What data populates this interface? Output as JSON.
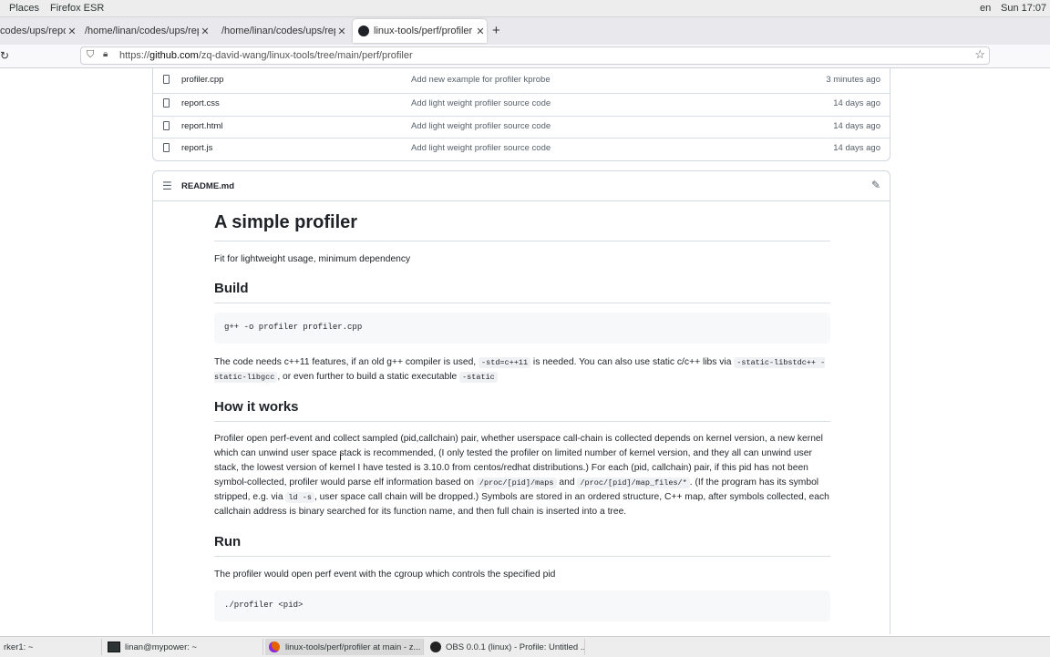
{
  "topbar": {
    "places": "Places",
    "app": "Firefox ESR",
    "lang": "en",
    "clock": "Sun 17:07"
  },
  "tabs": [
    {
      "label": "codes/ups/repo"
    },
    {
      "label": "/home/linan/codes/ups/repo"
    },
    {
      "label": "/home/linan/codes/ups/repo"
    },
    {
      "label": "linux-tools/perf/profiler a"
    }
  ],
  "newtab": "+",
  "url": {
    "prefix": "https://",
    "host": "github.com",
    "path": "/zq-david-wang/linux-tools/tree/main/perf/profiler"
  },
  "files": [
    {
      "name": "profiler.cpp",
      "message": "Add new example for profiler kprobe",
      "date": "3 minutes ago"
    },
    {
      "name": "report.css",
      "message": "Add light weight profiler source code",
      "date": "14 days ago"
    },
    {
      "name": "report.html",
      "message": "Add light weight profiler source code",
      "date": "14 days ago"
    },
    {
      "name": "report.js",
      "message": "Add light weight profiler source code",
      "date": "14 days ago"
    }
  ],
  "readme": {
    "filename": "README.md",
    "title": "A simple profiler",
    "intro": "Fit for lightweight usage, minimum dependency",
    "build_heading": "Build",
    "build_code": "g++ -o profiler profiler.cpp",
    "build_para": {
      "t1": "The code needs c++11 features, if an old g++ compiler is used, ",
      "c1": "-std=c++11",
      "t2": " is needed. You can also use static c/c++ libs via ",
      "c2": "-static-libstdc++ -static-libgcc",
      "t3": ", or even further to build a static executable ",
      "c3": "-static"
    },
    "how_heading": "How it works",
    "how_para": {
      "t1": "Profiler open perf-event and collect sampled (pid,callchain) pair, whether userspace call-chain is collected depends on kernel version, a new kernel which can unwind user space stack is recommended, (I only tested the profiler on limited number of kernel version, and they all can unwind user stack, the lowest version of kernel I have tested is 3.10.0 from centos/redhat distributions.) For each (pid, callchain) pair, if this pid has not been symbol-collected, profiler would parse elf information based on ",
      "c1": "/proc/[pid]/maps",
      "t2": " and ",
      "c2": "/proc/[pid]/map_files/*",
      "t3": ". (If the program has its symbol stripped, e.g. via ",
      "c3": "ld -s",
      "t4": ", user space call chain will be dropped.) Symbols are stored in an ordered structure, C++ map, after symbols collected, each callchain address is binary searched for its function name, and then full chain is inserted into a tree."
    },
    "run_heading": "Run",
    "run_para": "The profiler would open perf event with the cgroup which controls the specified pid",
    "run_code": "./profiler <pid>"
  },
  "taskbar": [
    {
      "label": "rker1: ~"
    },
    {
      "label": "linan@mypower: ~"
    },
    {
      "label": "linux-tools/perf/profiler at main - z..."
    },
    {
      "label": "OBS 0.0.1 (linux) - Profile: Untitled ..."
    }
  ]
}
